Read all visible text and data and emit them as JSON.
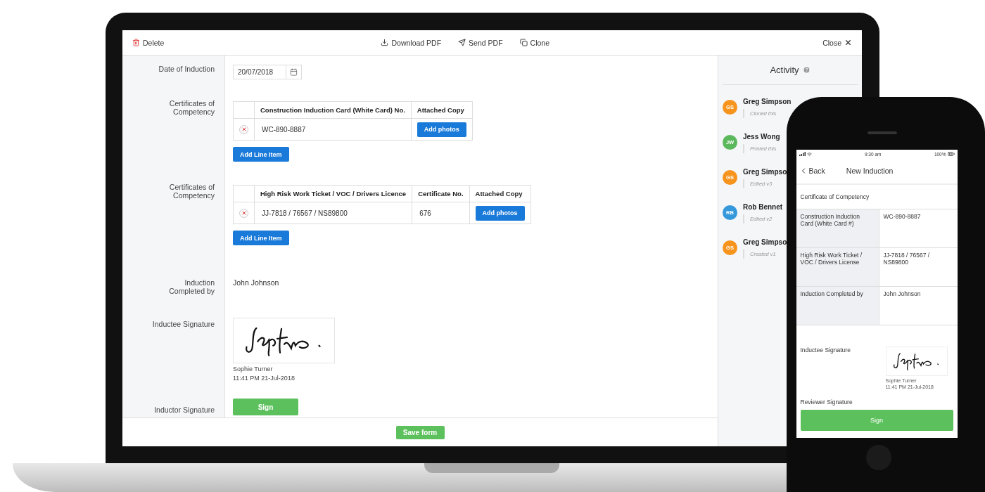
{
  "toolbar": {
    "delete": "Delete",
    "actions": [
      {
        "kind": "download",
        "label": "Download PDF"
      },
      {
        "kind": "send",
        "label": "Send PDF"
      },
      {
        "kind": "clone",
        "label": "Clone"
      }
    ],
    "close": "Close"
  },
  "form": {
    "fields": [
      {
        "kind": "date",
        "label": "Date of Induction",
        "value": "20/07/2018"
      },
      {
        "kind": "table",
        "label": "Certificates of Competency",
        "columns": [
          "Construction Induction Card (White Card) No.",
          "Attached Copy"
        ],
        "rows": [
          {
            "values": [
              "WC-890-8887"
            ],
            "action": "Add photos"
          }
        ],
        "add_button": "Add Line Item"
      },
      {
        "kind": "table",
        "label": "Certificates of Competency",
        "columns": [
          "High Risk Work Ticket / VOC / Drivers Licence",
          "Certificate No.",
          "Attached Copy"
        ],
        "rows": [
          {
            "values": [
              "JJ-7818 / 76567 / NS89800",
              "676"
            ],
            "action": "Add photos"
          }
        ],
        "add_button": "Add Line Item"
      },
      {
        "kind": "text",
        "label": "Induction Completed by",
        "value": "John Johnson"
      },
      {
        "kind": "signature",
        "label": "Inductee Signature",
        "signer": "Sophie Turner",
        "time": "11:41 PM 21-Jul-2018"
      },
      {
        "kind": "sign",
        "label": "Inductor Signature",
        "button": "Sign"
      }
    ],
    "save": "Save form"
  },
  "activity": {
    "title": "Activity",
    "entries": [
      {
        "initials": "GS",
        "color": "#f7941d",
        "name": "Greg Simpson",
        "action": "Cloned this"
      },
      {
        "initials": "JW",
        "color": "#5cb85c",
        "name": "Jess Wong",
        "action": "Printed this"
      },
      {
        "initials": "GS",
        "color": "#f7941d",
        "name": "Greg Simpso",
        "action": "Edited v3"
      },
      {
        "initials": "RB",
        "color": "#3498db",
        "name": "Rob Bennet",
        "action": "Edited v2"
      },
      {
        "initials": "GS",
        "color": "#f7941d",
        "name": "Greg Simpso",
        "action": "Created v1"
      }
    ]
  },
  "phone": {
    "time": "9:30 am",
    "battery": "100%",
    "back": "Back",
    "title": "New Induction",
    "section": "Certificate of Competency",
    "rows": [
      {
        "label": "Construction Induction Card (White Card #)",
        "value": "WC-890-8887"
      },
      {
        "label": "High Risk Work Ticket / VOC / Drivers License",
        "value": "JJ-7818 / 76567 / NS89800"
      },
      {
        "label": "Induction Completed by",
        "value": "John Johnson"
      }
    ],
    "signature": {
      "label": "Inductee Signature",
      "signer": "Sophie Turner",
      "time": "11:41 PM 21-Jul-2018"
    },
    "reviewer": "Reviewer Signature",
    "sign": "Sign"
  }
}
